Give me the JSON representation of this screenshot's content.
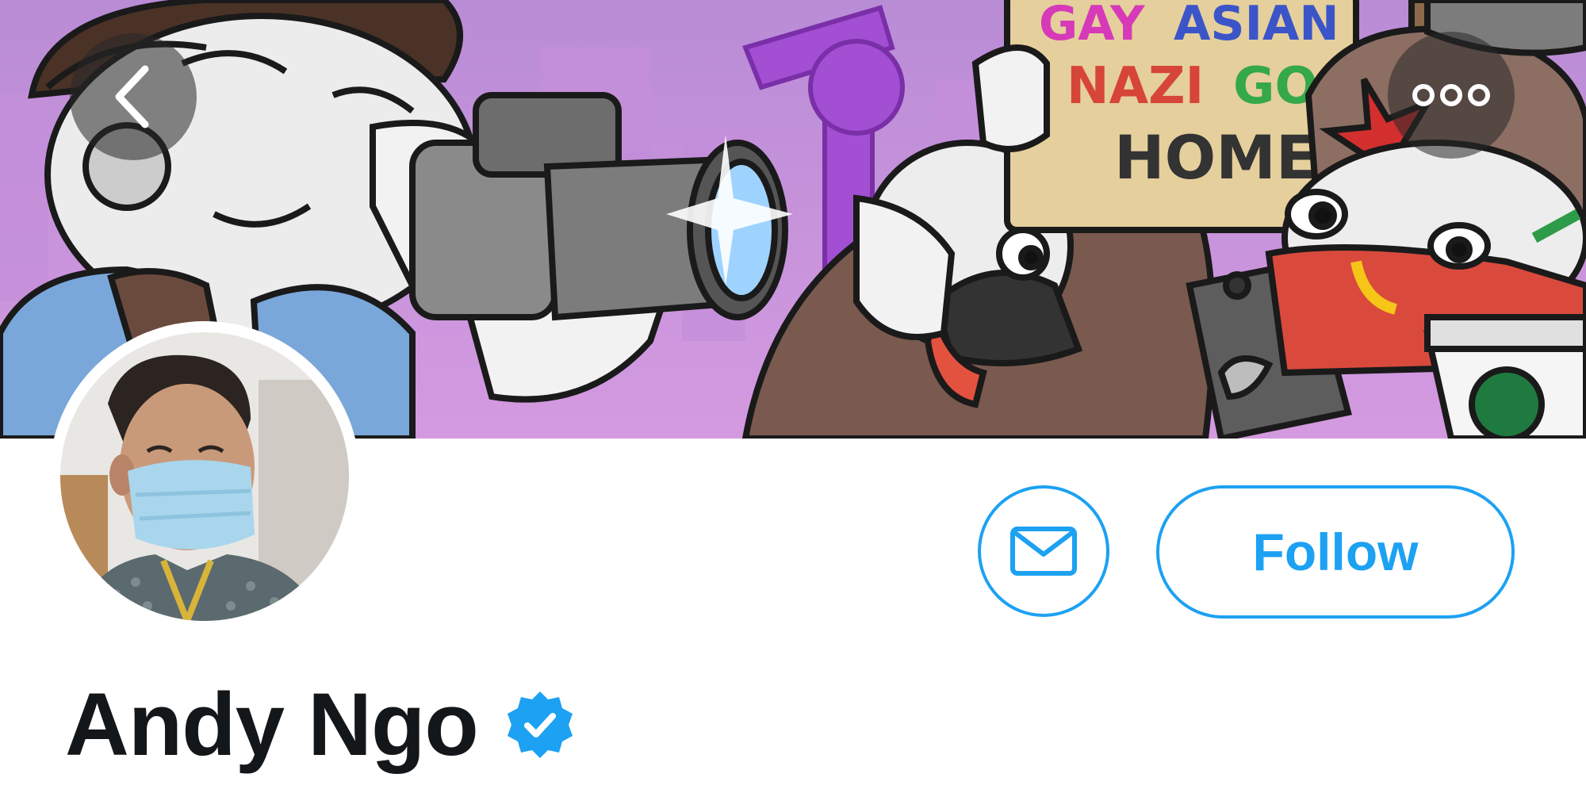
{
  "header": {
    "back_icon": "chevron-left-icon",
    "more_icon": "more-dots-icon"
  },
  "banner": {
    "sign_lines": [
      "GAY ASIAN",
      "NAZI GO",
      "HOME"
    ]
  },
  "actions": {
    "message_icon": "mail-icon",
    "follow_label": "Follow"
  },
  "profile": {
    "display_name": "Andy Ngo",
    "verified": true
  },
  "colors": {
    "accent": "#1da1f2",
    "name_text": "#14171a",
    "banner_bg": "#c07fd8"
  }
}
